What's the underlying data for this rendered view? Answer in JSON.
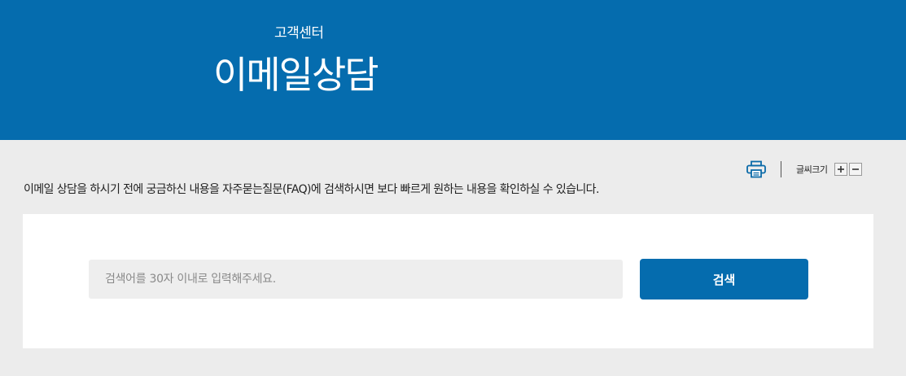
{
  "header": {
    "breadcrumb": "고객센터",
    "title": "이메일상담"
  },
  "tools": {
    "print_icon": "printer-icon",
    "font_size_label": "글씨크기",
    "increase_label": "+",
    "decrease_label": "−"
  },
  "intro": "이메일 상담을 하시기 전에 궁금하신 내용을 자주묻는질문(FAQ)에 검색하시면 보다 빠르게 원하는 내용을 확인하실 수 있습니다.",
  "search": {
    "placeholder": "검색어를 30자 이내로 입력해주세요.",
    "value": "",
    "button_label": "검색"
  },
  "colors": {
    "brand": "#056cae",
    "background": "#ececec",
    "panel": "#ffffff",
    "input_bg": "#eeeeee"
  }
}
